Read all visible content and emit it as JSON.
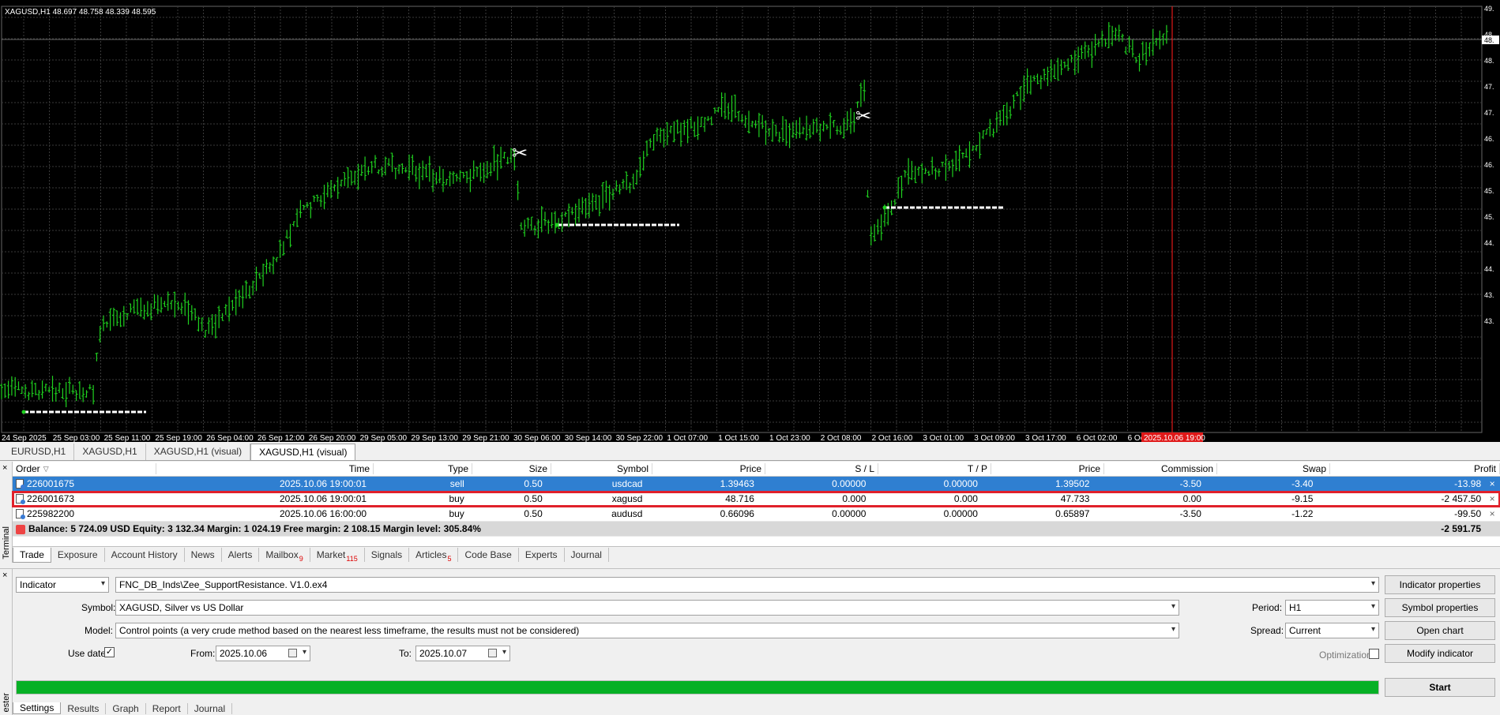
{
  "chart": {
    "title": "XAGUSD,H1  48.697 48.758 48.339 48.595",
    "price_ticks": [
      "49.",
      "48.",
      "48.",
      "47.",
      "47.",
      "46.",
      "46.",
      "45.",
      "45.",
      "44.",
      "44.",
      "43.",
      "43."
    ],
    "time_ticks": [
      "24 Sep 2025",
      "25 Sep 03:00",
      "25 Sep 11:00",
      "25 Sep 19:00",
      "26 Sep 04:00",
      "26 Sep 12:00",
      "26 Sep 20:00",
      "29 Sep 05:00",
      "29 Sep 13:00",
      "29 Sep 21:00",
      "30 Sep 06:00",
      "30 Sep 14:00",
      "30 Sep 22:00",
      "1 Oct 07:00",
      "1 Oct 15:00",
      "1 Oct 23:00",
      "2 Oct 08:00",
      "2 Oct 16:00",
      "3 Oct 01:00",
      "3 Oct 09:00",
      "3 Oct 17:00",
      "6 Oct 02:00",
      "6 Oct 1"
    ],
    "current_time_label": "2025.10.06 19:00",
    "current_price_label": "48.",
    "colors": {
      "background": "#000000",
      "grid": "#3a3a3a",
      "bars": "#1fd11f",
      "marker": "#e01818",
      "level": "#ffffff"
    },
    "icons": [
      "scissors-icon",
      "scissors-icon"
    ]
  },
  "chart_tabs": [
    "EURUSD,H1",
    "XAGUSD,H1",
    "XAGUSD,H1 (visual)",
    "XAGUSD,H1 (visual)"
  ],
  "terminal": {
    "side_label": "Terminal",
    "headers": [
      "Order",
      "Time",
      "Type",
      "Size",
      "Symbol",
      "Price",
      "S / L",
      "T / P",
      "Price",
      "Commission",
      "Swap",
      "Profit"
    ],
    "rows": [
      {
        "order": "226001675",
        "time": "2025.10.06 19:00:01",
        "type": "sell",
        "size": "0.50",
        "symbol": "usdcad",
        "price": "1.39463",
        "sl": "0.00000",
        "tp": "0.00000",
        "price2": "1.39502",
        "commission": "-3.50",
        "swap": "-3.40",
        "profit": "-13.98"
      },
      {
        "order": "226001673",
        "time": "2025.10.06 19:00:01",
        "type": "buy",
        "size": "0.50",
        "symbol": "xagusd",
        "price": "48.716",
        "sl": "0.000",
        "tp": "0.000",
        "price2": "47.733",
        "commission": "0.00",
        "swap": "-9.15",
        "profit": "-2 457.50"
      },
      {
        "order": "225982200",
        "time": "2025.10.06 16:00:00",
        "type": "buy",
        "size": "0.50",
        "symbol": "audusd",
        "price": "0.66096",
        "sl": "0.00000",
        "tp": "0.00000",
        "price2": "0.65897",
        "commission": "-3.50",
        "swap": "-1.22",
        "profit": "-99.50"
      }
    ],
    "balance": "Balance: 5 724.09 USD  Equity: 3 132.34  Margin: 1 024.19  Free margin: 2 108.15  Margin level: 305.84%",
    "total_profit": "-2 591.75",
    "tabs": [
      {
        "label": "Trade",
        "badge": ""
      },
      {
        "label": "Exposure",
        "badge": ""
      },
      {
        "label": "Account History",
        "badge": ""
      },
      {
        "label": "News",
        "badge": ""
      },
      {
        "label": "Alerts",
        "badge": ""
      },
      {
        "label": "Mailbox",
        "badge": "9"
      },
      {
        "label": "Market",
        "badge": "115"
      },
      {
        "label": "Signals",
        "badge": ""
      },
      {
        "label": "Articles",
        "badge": "5"
      },
      {
        "label": "Code Base",
        "badge": ""
      },
      {
        "label": "Experts",
        "badge": ""
      },
      {
        "label": "Journal",
        "badge": ""
      }
    ]
  },
  "tester": {
    "side_label": "ester",
    "mode": "Indicator",
    "program": "FNC_DB_Inds\\Zee_SupportResistance. V1.0.ex4",
    "symbol_label": "Symbol:",
    "symbol": "XAGUSD, Silver vs US Dollar",
    "model_label": "Model:",
    "model": "Control points (a very crude method based on the nearest less timeframe, the results must not be considered)",
    "use_date_label": "Use date",
    "use_date_checked": "✓",
    "from_label": "From:",
    "from": "2025.10.06",
    "to_label": "To:",
    "to": "2025.10.07",
    "period_label": "Period:",
    "period": "H1",
    "spread_label": "Spread:",
    "spread": "Current",
    "optimization_label": "Optimization",
    "buttons": {
      "indicator_properties": "Indicator properties",
      "symbol_properties": "Symbol properties",
      "open_chart": "Open chart",
      "modify_indicator": "Modify indicator",
      "start": "Start"
    },
    "progress_fraction": 1.0,
    "tabs": [
      "Settings",
      "Results",
      "Graph",
      "Report",
      "Journal"
    ]
  }
}
